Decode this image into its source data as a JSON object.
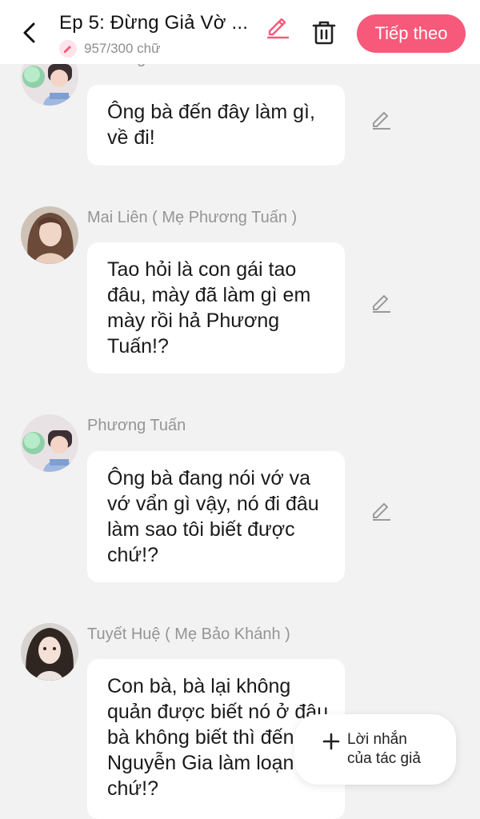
{
  "header": {
    "title": "Ep 5: Đừng Giả Vờ ...",
    "word_count": "957/300 chữ",
    "next_label": "Tiếp theo",
    "accent_color": "#f7597a"
  },
  "messages": [
    {
      "sender": "Phương Tuấn",
      "text": "Ông bà đến đây làm gì, về đi!"
    },
    {
      "sender": "Mai Liên ( Mẹ Phương Tuấn )",
      "text": "Tao hỏi là con gái tao đâu, mày đã làm gì em mày rồi hả Phương Tuấn!?"
    },
    {
      "sender": "Phương Tuấn",
      "text": "Ông bà đang nói vớ va vớ vẩn gì vậy, nó đi đâu làm sao tôi biết được chứ!?"
    },
    {
      "sender": "Tuyết Huệ ( Mẹ Bảo Khánh )",
      "text": "Con bà, bà lại không quản được biết nó ở đâu bà không biết thì đến Nguyễn Gia làm loạn gì chứ!?"
    }
  ],
  "author_note": {
    "label": "Lời nhắn của tác giả"
  },
  "icons": {
    "back": "chevron-left-icon",
    "title_edit": "pencil-icon",
    "delete": "trash-icon",
    "message_edit": "pencil-icon",
    "add": "plus-icon"
  }
}
